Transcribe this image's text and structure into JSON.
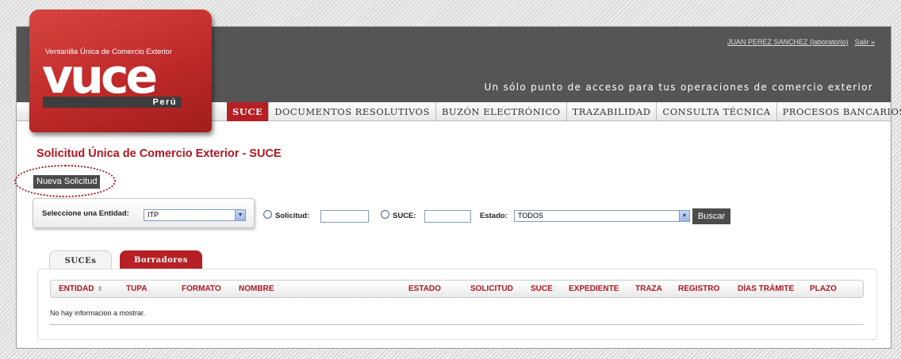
{
  "header": {
    "user_link": "JUAN PEREZ SANCHEZ (laboratorio)",
    "logout_link": "Salir »",
    "tagline": "Un sólo punto de acceso para tus operaciones de comercio exterior"
  },
  "logo": {
    "subtitle": "Ventanilla Única de Comercio Exterior",
    "word": "vuce",
    "country": "Perú"
  },
  "nav": {
    "items": [
      {
        "label": "SUCE"
      },
      {
        "label": "DOCUMENTOS RESOLUTIVOS"
      },
      {
        "label": "BUZÓN ELECTRÓNICO"
      },
      {
        "label": "TRAZABILIDAD"
      },
      {
        "label": "CONSULTA TÉCNICA"
      },
      {
        "label": "PROCESOS BANCARIOS"
      }
    ],
    "active_index": 0
  },
  "page": {
    "title": "Solicitud Única de Comercio Exterior - SUCE",
    "new_button": "Nueva Solicitud"
  },
  "filters": {
    "entity_label": "Seleccione una Entidad:",
    "entity_value": "ITP",
    "solicitud_label": "Solicitud:",
    "solicitud_value": "",
    "suce_label": "SUCE:",
    "suce_value": "",
    "estado_label": "Estado:",
    "estado_value": "TODOS",
    "search_button": "Buscar"
  },
  "tabs": [
    {
      "label": "SUCEs",
      "active": true
    },
    {
      "label": "Borradores",
      "active": false
    }
  ],
  "table": {
    "columns": [
      "ENTIDAD",
      "TUPA",
      "FORMATO",
      "NOMBRE",
      "ESTADO",
      "SOLICITUD",
      "SUCE",
      "EXPEDIENTE",
      "TRAZA",
      "REGISTRO",
      "DÍAS TRÁMITE",
      "PLAZO"
    ],
    "empty_message": "No hay informacion a mostrar."
  },
  "colors": {
    "brand_red": "#b61f25",
    "header_gray": "#555555",
    "button_dark": "#4b4b4b"
  },
  "icons": {
    "sort": "sort-icon",
    "dropdown": "chevron-down-icon"
  }
}
